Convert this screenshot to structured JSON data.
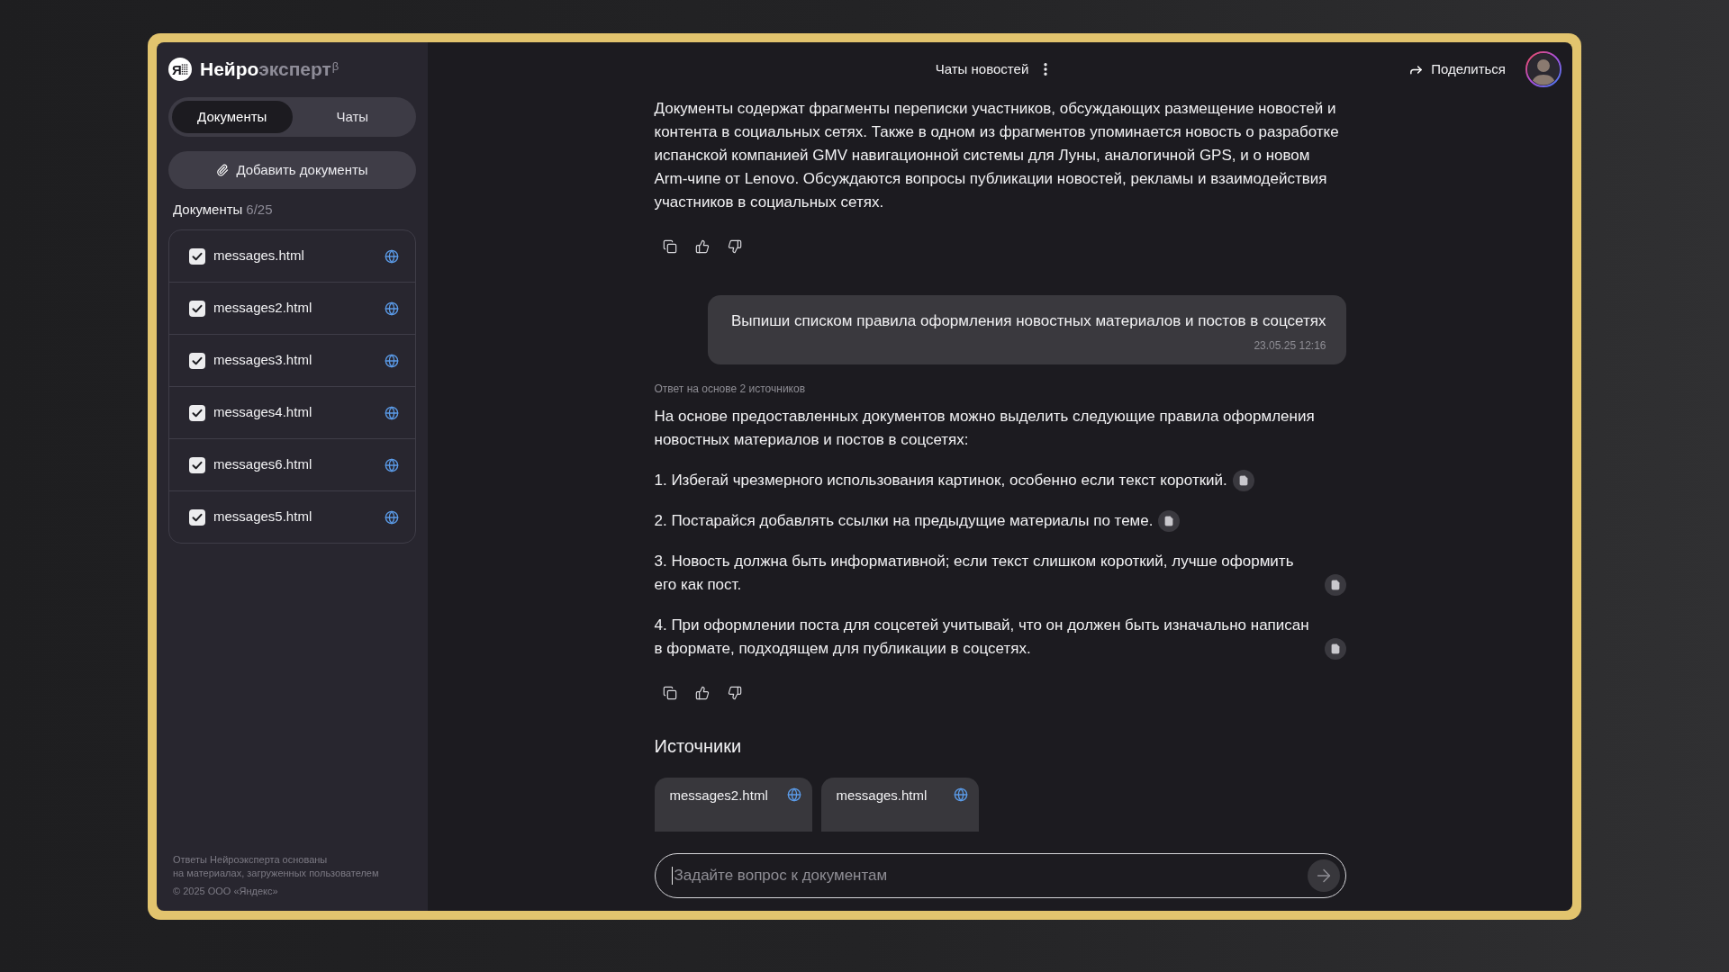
{
  "sidebar": {
    "brand": {
      "mark": "Я",
      "primary": "Нейро",
      "secondary": "эксперт",
      "superscript": "β"
    },
    "tabs": [
      {
        "label": "Документы",
        "selected": true
      },
      {
        "label": "Чаты",
        "selected": false
      }
    ],
    "add_button": "Добавить документы",
    "documents_heading": {
      "label": "Документы",
      "count": "6/25"
    },
    "documents": [
      {
        "name": "messages.html",
        "checked": true
      },
      {
        "name": "messages2.html",
        "checked": true
      },
      {
        "name": "messages3.html",
        "checked": true
      },
      {
        "name": "messages4.html",
        "checked": true
      },
      {
        "name": "messages6.html",
        "checked": true
      },
      {
        "name": "messages5.html",
        "checked": true
      }
    ],
    "footer": {
      "disclaimer_lines": [
        "Ответы Нейроэксперта основаны",
        "на материалах, загруженных пользователем"
      ],
      "copyright": "© 2025 ООО «Яндекс»"
    }
  },
  "header": {
    "title": "Чаты новостей",
    "share": "Поделиться"
  },
  "messages": [
    {
      "kind": "assistant",
      "paragraphs": [
        {
          "text": "Документы содержат фрагменты переписки участников, обсуждающих размещение новостей и контента в социальных сетях. Также в одном из фрагментов упоминается новость о разработке испанской компанией GMV навигационной системы для Луны, аналогичной GPS, и о новом Arm-чипе от Lenovo. Обсуждаются вопросы публикации новостей, рекламы и взаимодействия участников в социальных сетях.",
          "cited": false
        }
      ]
    },
    {
      "kind": "user",
      "text": "Выпиши списком правила оформления новостных материалов и постов в соцсетях",
      "time": "23.05.25 12:16"
    },
    {
      "kind": "assistant",
      "note": "Ответ на основе 2 источников",
      "paragraphs": [
        {
          "text": "На основе предоставленных документов можно выделить следующие правила оформления новостных материалов и постов в соцсетях:",
          "cited": false
        },
        {
          "text": "1. Избегай чрезмерного использования картинок, особенно если текст короткий.",
          "cited": true
        },
        {
          "text": "2. Постарайся добавлять ссылки на предыдущие материалы по теме.",
          "cited": true
        },
        {
          "text": "3. Новость должна быть информативной; если текст слишком короткий, лучше оформить его как пост.",
          "cited": true
        },
        {
          "text": "4. При оформлении поста для соцсетей учитывай, что он должен быть изначально написан в формате, подходящем для публикации в соцсетях.",
          "cited": true
        }
      ]
    }
  ],
  "sources": {
    "title": "Источники",
    "items": [
      {
        "name": "messages2.html"
      },
      {
        "name": "messages.html"
      }
    ]
  },
  "composer": {
    "placeholder": "Задайте вопрос к документам",
    "focused": true
  }
}
